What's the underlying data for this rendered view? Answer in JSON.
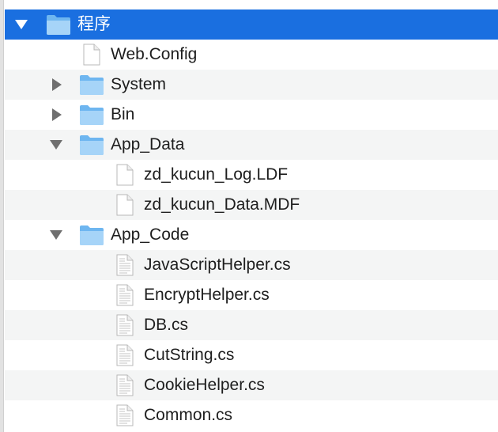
{
  "tree": {
    "root": {
      "label": "程序",
      "icon": "folder-icon"
    },
    "web_config": {
      "label": "Web.Config",
      "icon": "file-icon"
    },
    "system": {
      "label": "System",
      "icon": "folder-icon"
    },
    "bin": {
      "label": "Bin",
      "icon": "folder-icon"
    },
    "app_data": {
      "label": "App_Data",
      "icon": "folder-icon",
      "files": [
        {
          "label": "zd_kucun_Log.LDF",
          "icon": "file-icon"
        },
        {
          "label": "zd_kucun_Data.MDF",
          "icon": "file-icon"
        }
      ]
    },
    "app_code": {
      "label": "App_Code",
      "icon": "folder-icon",
      "files": [
        {
          "label": "JavaScriptHelper.cs",
          "icon": "text-document-icon"
        },
        {
          "label": "EncryptHelper.cs",
          "icon": "text-document-icon"
        },
        {
          "label": "DB.cs",
          "icon": "text-document-icon"
        },
        {
          "label": "CutString.cs",
          "icon": "text-document-icon"
        },
        {
          "label": "CookieHelper.cs",
          "icon": "text-document-icon"
        },
        {
          "label": "Common.cs",
          "icon": "text-document-icon"
        }
      ]
    }
  },
  "colors": {
    "selection": "#1a6fe0",
    "alternate_row": "#f4f5f5",
    "folder": "#8fc8f5",
    "disclosure": "#6f6f6f"
  }
}
